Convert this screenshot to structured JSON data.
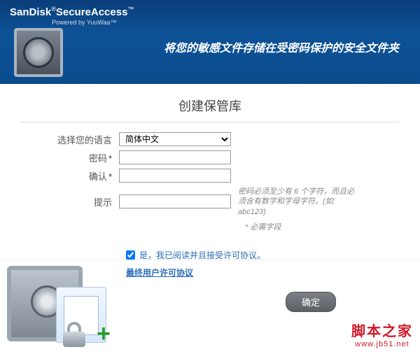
{
  "brand": {
    "name": "SanDisk",
    "product": "SecureAccess",
    "reg": "®",
    "tm": "™",
    "powered": "Powered by YuuWaa™"
  },
  "tagline": "将您的敏感文件存储在受密码保护的安全文件夹",
  "form": {
    "title": "创建保管库",
    "language_label": "选择您的语言",
    "language_value": "简体中文",
    "language_options": [
      "简体中文"
    ],
    "password_label": "密码",
    "confirm_label": "确认",
    "hint_label": "提示",
    "password_value": "",
    "confirm_value": "",
    "hint_value": "",
    "password_hint_note": "密码必须至少有 6 个字符，而且必须含有数字和字母字符。(如: abc123)",
    "required_note": "* 必需字段"
  },
  "consent": {
    "checked": true,
    "text": "是，我已阅读并且接受许可协议。",
    "eula_link": "最终用户许可协议"
  },
  "buttons": {
    "ok": "确定"
  },
  "watermark": {
    "site_name": "脚本之家",
    "site_url": "www.jb51.net"
  }
}
